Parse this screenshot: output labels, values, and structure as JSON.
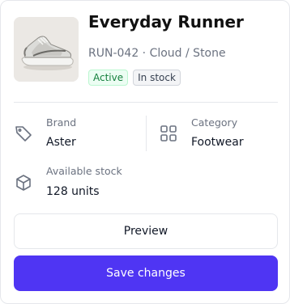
{
  "product": {
    "name": "Everyday Runner",
    "sku_color": "RUN-042 · Cloud / Stone",
    "image_icon": "sneaker-image",
    "badges": {
      "status": "Active",
      "stock": "In stock"
    }
  },
  "details": {
    "brand": {
      "label": "Brand",
      "value": "Aster",
      "icon": "tag-icon"
    },
    "category": {
      "label": "Category",
      "value": "Footwear",
      "icon": "grid-icon"
    },
    "stock": {
      "label": "Available stock",
      "value": "128 units",
      "icon": "box-icon"
    }
  },
  "actions": {
    "preview_label": "Preview",
    "save_label": "Save changes"
  },
  "colors": {
    "accent": "#4f35f3",
    "active_badge_text": "#15803d",
    "active_badge_bg": "#ecfdf3"
  }
}
